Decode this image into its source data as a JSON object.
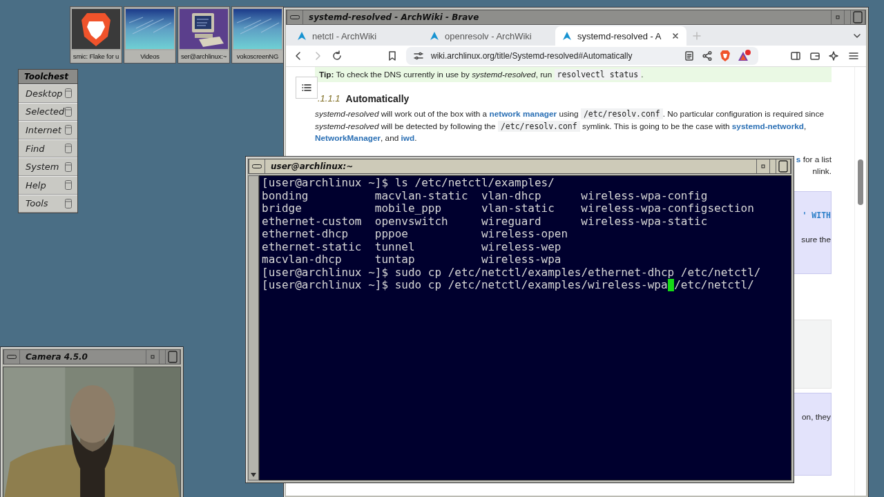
{
  "desktop_icons": [
    {
      "label": "smic: Flake for u",
      "kind": "shield"
    },
    {
      "label": "Videos",
      "kind": "picture"
    },
    {
      "label": "ser@archlinux:~",
      "kind": "computer"
    },
    {
      "label": "vokoscreenNG",
      "kind": "picture"
    }
  ],
  "toolchest": {
    "title": "Toolchest",
    "items": [
      "Desktop",
      "Selected",
      "Internet",
      "Find",
      "System",
      "Help",
      "Tools"
    ]
  },
  "browser": {
    "title": "systemd-resolved - ArchWiki - Brave",
    "focused": false,
    "tabs": [
      {
        "label": "netctl - ArchWiki",
        "selected": false
      },
      {
        "label": "openresolv - ArchWiki",
        "selected": false
      },
      {
        "label": "systemd-resolved - A",
        "selected": true
      }
    ],
    "url": "wiki.archlinux.org/title/Systemd-resolved#Automatically",
    "tip": [
      {
        "kind": "strong",
        "text": "Tip:"
      },
      {
        "kind": "text",
        "text": " To check the DNS currently in use by "
      },
      {
        "kind": "em",
        "text": "systemd-resolved"
      },
      {
        "kind": "text",
        "text": ", run "
      },
      {
        "kind": "code",
        "text": "resolvectl status"
      },
      {
        "kind": "text",
        "text": "."
      }
    ],
    "heading": {
      "number": ".1.1.1",
      "title": "Automatically"
    },
    "paragraph": [
      {
        "kind": "em",
        "text": "systemd-resolved"
      },
      {
        "kind": "text",
        "text": " will work out of the box with a "
      },
      {
        "kind": "link",
        "text": "network manager"
      },
      {
        "kind": "text",
        "text": " using "
      },
      {
        "kind": "code",
        "text": "/etc/resolv.conf"
      },
      {
        "kind": "text",
        "text": ". No particular configuration is required since "
      },
      {
        "kind": "em",
        "text": "systemd-resolved"
      },
      {
        "kind": "text",
        "text": " will be detected by following the "
      },
      {
        "kind": "code",
        "text": "/etc/resolv.conf"
      },
      {
        "kind": "text",
        "text": " symlink. This is going to be the case with "
      },
      {
        "kind": "link",
        "text": "systemd-networkd"
      },
      {
        "kind": "text",
        "text": ", "
      },
      {
        "kind": "link",
        "text": "NetworkManager"
      },
      {
        "kind": "text",
        "text": ", and "
      },
      {
        "kind": "link",
        "text": "iwd"
      },
      {
        "kind": "text",
        "text": "."
      }
    ],
    "blocks": [
      {
        "kind": "lines",
        "lines": [
          [
            {
              "kind": "link",
              "text": "s"
            },
            {
              "kind": "text",
              "text": " for a list"
            }
          ],
          [
            {
              "kind": "text",
              "text": "nlink."
            }
          ]
        ]
      },
      {
        "kind": "note",
        "lines": [
          [
            {
              "kind": "codelink",
              "text": "' WITH"
            }
          ],
          [
            {
              "kind": "text",
              "text": "sure the"
            }
          ]
        ]
      },
      {
        "kind": "grey"
      },
      {
        "kind": "note",
        "lines": [
          [
            {
              "kind": "text",
              "text": "on, they"
            }
          ]
        ]
      }
    ]
  },
  "terminal": {
    "title": "user@archlinux:~",
    "focused": true,
    "lines": [
      {
        "kind": "command",
        "prompt": "[user@archlinux ~]$",
        "command": "ls /etc/netctl/examples/",
        "cursor": false
      },
      {
        "kind": "columns",
        "cells": [
          "bonding",
          "macvlan-static",
          "vlan-dhcp",
          "wireless-wpa-config"
        ]
      },
      {
        "kind": "columns",
        "cells": [
          "bridge",
          "mobile_ppp",
          "vlan-static",
          "wireless-wpa-configsection"
        ]
      },
      {
        "kind": "columns",
        "cells": [
          "ethernet-custom",
          "openvswitch",
          "wireguard",
          "wireless-wpa-static"
        ]
      },
      {
        "kind": "columns",
        "cells": [
          "ethernet-dhcp",
          "pppoe",
          "wireless-open"
        ]
      },
      {
        "kind": "columns",
        "cells": [
          "ethernet-static",
          "tunnel",
          "wireless-wep"
        ]
      },
      {
        "kind": "columns",
        "cells": [
          "macvlan-dhcp",
          "tuntap",
          "wireless-wpa"
        ]
      },
      {
        "kind": "command",
        "prompt": "[user@archlinux ~]$",
        "command": "sudo cp /etc/netctl/examples/ethernet-dhcp /etc/netctl/",
        "cursor": false
      },
      {
        "kind": "command",
        "prompt": "[user@archlinux ~]$",
        "command": "sudo cp /etc/netctl/examples/wireless-wpa",
        "cursor": true,
        "after": "/etc/netctl/"
      }
    ]
  },
  "camera": {
    "title": "Camera 4.5.0",
    "focused": false
  }
}
